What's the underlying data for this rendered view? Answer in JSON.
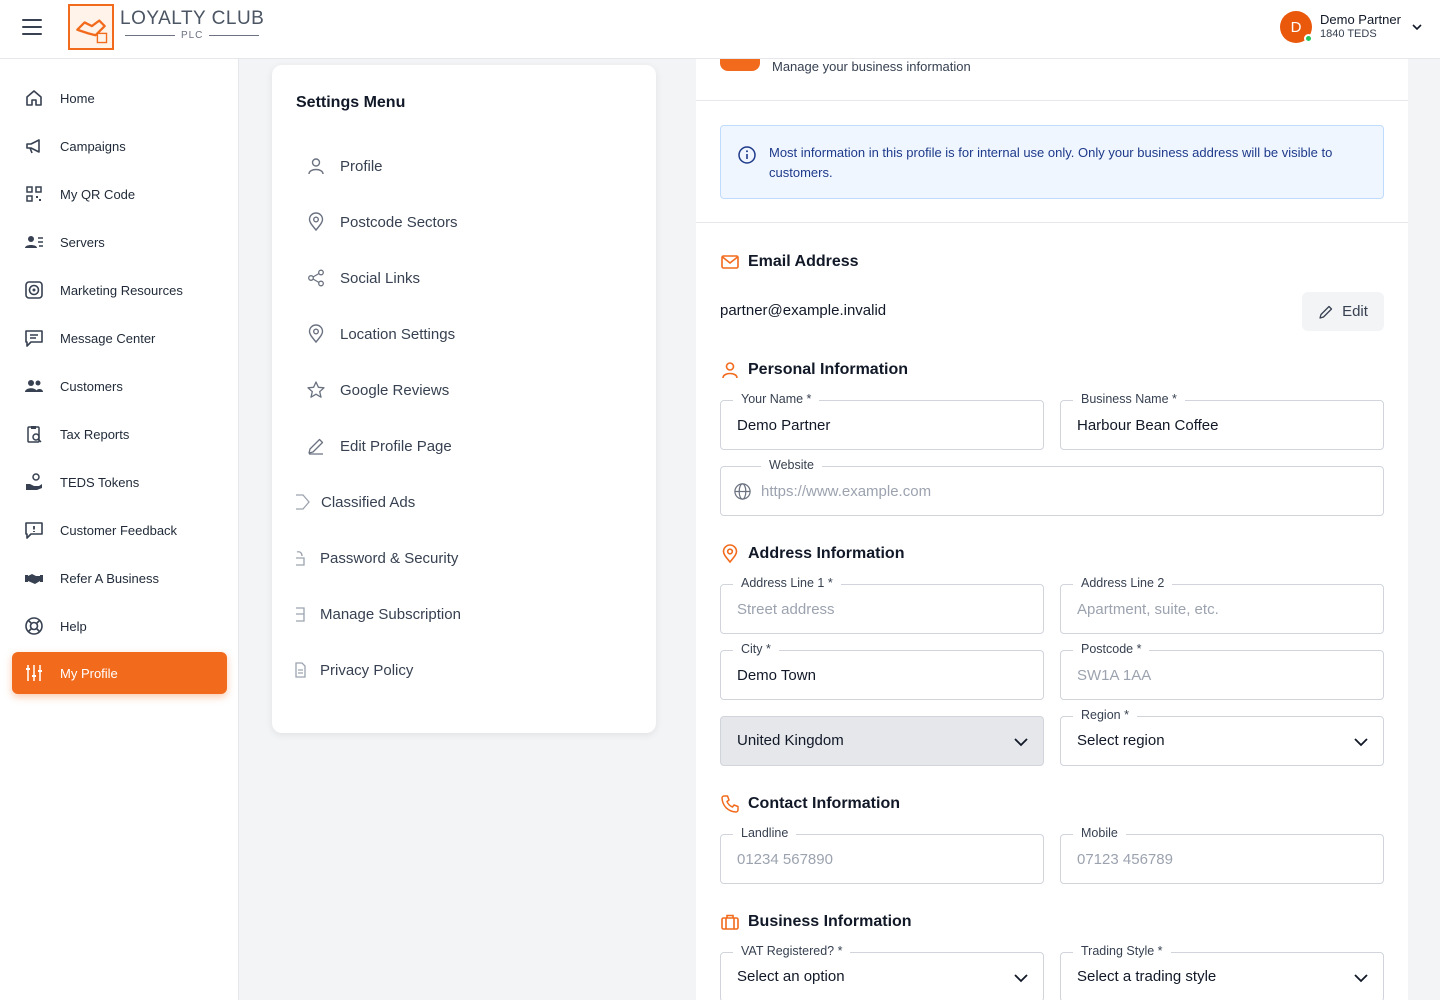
{
  "header": {
    "logo_title": "LOYALTY CLUB",
    "logo_sub": "PLC",
    "user_initial": "D",
    "user_name": "Demo Partner",
    "user_sub": "1840 TEDS"
  },
  "sidebar": {
    "items": [
      {
        "label": "Home",
        "icon": "home-icon"
      },
      {
        "label": "Campaigns",
        "icon": "megaphone-icon"
      },
      {
        "label": "My QR Code",
        "icon": "qr-code-icon"
      },
      {
        "label": "Servers",
        "icon": "users-list-icon"
      },
      {
        "label": "Marketing Resources",
        "icon": "target-icon"
      },
      {
        "label": "Message Center",
        "icon": "message-icon"
      },
      {
        "label": "Customers",
        "icon": "group-icon"
      },
      {
        "label": "Tax Reports",
        "icon": "report-icon"
      },
      {
        "label": "TEDS Tokens",
        "icon": "coins-icon"
      },
      {
        "label": "Customer Feedback",
        "icon": "feedback-icon"
      },
      {
        "label": "Refer A Business",
        "icon": "handshake-icon"
      },
      {
        "label": "Help",
        "icon": "lifebuoy-icon"
      },
      {
        "label": "My Profile",
        "icon": "sliders-icon",
        "active": true
      }
    ]
  },
  "settings": {
    "title": "Settings Menu",
    "items": [
      {
        "label": "Profile",
        "icon": "user-icon"
      },
      {
        "label": "Postcode Sectors",
        "icon": "map-pin-icon"
      },
      {
        "label": "Social Links",
        "icon": "share-icon"
      },
      {
        "label": "Location Settings",
        "icon": "map-pin-icon"
      },
      {
        "label": "Google Reviews",
        "icon": "star-icon"
      },
      {
        "label": "Edit Profile Page",
        "icon": "pencil-icon"
      },
      {
        "label": "Classified Ads",
        "icon": "tag-icon"
      },
      {
        "label": "Password & Security",
        "icon": "lock-icon"
      },
      {
        "label": "Manage Subscription",
        "icon": "list-icon"
      },
      {
        "label": "Privacy Policy",
        "icon": "document-icon"
      }
    ]
  },
  "main": {
    "subtitle": "Manage your business information",
    "info": "Most information in this profile is for internal use only. Only your business address will be visible to customers.",
    "email": {
      "heading": "Email Address",
      "value": "partner@example.invalid",
      "edit_label": "Edit"
    },
    "personal": {
      "heading": "Personal Information",
      "your_name_label": "Your Name *",
      "your_name_value": "Demo Partner",
      "business_name_label": "Business Name *",
      "business_name_value": "Harbour Bean Coffee",
      "website_label": "Website",
      "website_placeholder": "https://www.example.com"
    },
    "address": {
      "heading": "Address Information",
      "line1_label": "Address Line 1 *",
      "line1_placeholder": "Street address",
      "line2_label": "Address Line 2",
      "line2_placeholder": "Apartment, suite, etc.",
      "city_label": "City *",
      "city_value": "Demo Town",
      "postcode_label": "Postcode *",
      "postcode_placeholder": "SW1A 1AA",
      "country_value": "United Kingdom",
      "region_label": "Region *",
      "region_value": "Select region"
    },
    "contact": {
      "heading": "Contact Information",
      "landline_label": "Landline",
      "landline_placeholder": "01234 567890",
      "mobile_label": "Mobile",
      "mobile_placeholder": "07123 456789"
    },
    "business": {
      "heading": "Business Information",
      "vat_label": "VAT Registered? *",
      "vat_value": "Select an option",
      "trading_label": "Trading Style *",
      "trading_value": "Select a trading style"
    }
  },
  "colors": {
    "accent": "#f26b1d",
    "info_bg": "#eff6ff",
    "info_text": "#1e3a8a"
  }
}
